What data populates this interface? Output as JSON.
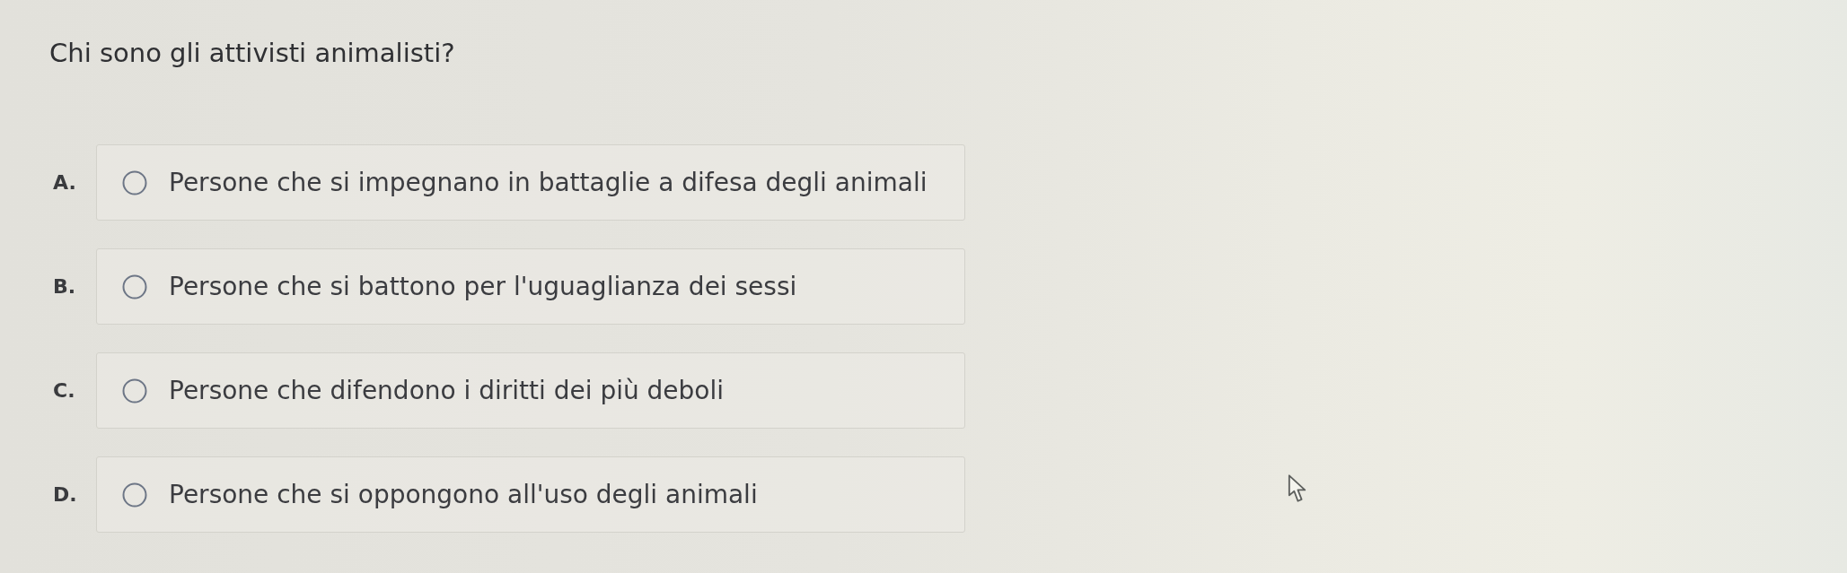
{
  "question": {
    "text": "Chi sono gli attivisti animalisti?"
  },
  "options": [
    {
      "letter": "A.",
      "text": "Persone che si impegnano in battaglie a difesa degli animali",
      "selected": false
    },
    {
      "letter": "B.",
      "text": "Persone che si battono per l'uguaglianza dei sessi",
      "selected": false
    },
    {
      "letter": "C.",
      "text": "Persone che difendono i diritti dei più deboli",
      "selected": false
    },
    {
      "letter": "D.",
      "text": "Persone che si oppongono all'uso degli animali",
      "selected": false
    }
  ]
}
